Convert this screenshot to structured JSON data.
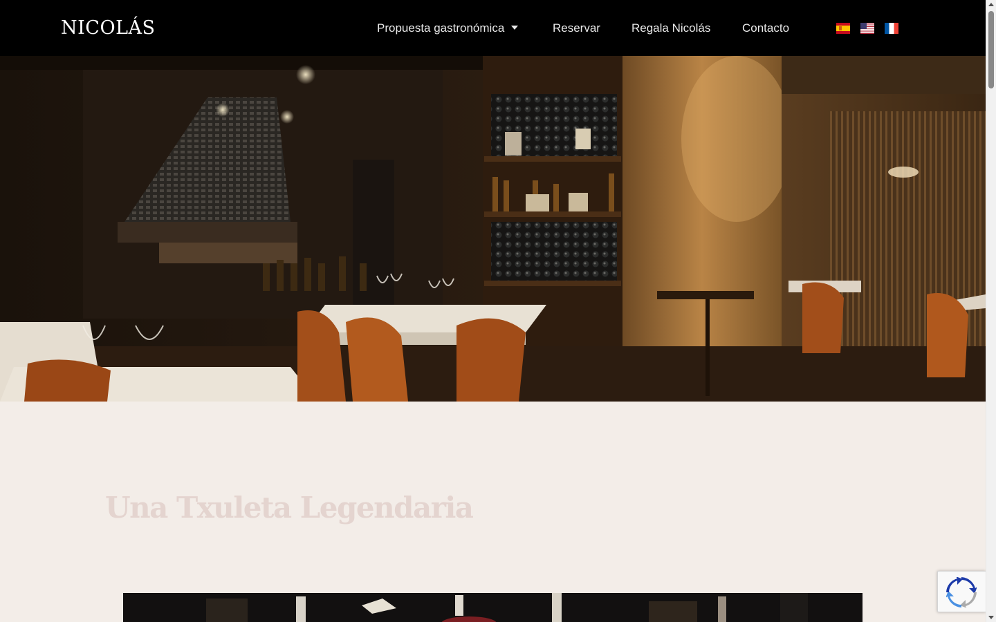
{
  "header": {
    "logo": "NICOLÁS",
    "nav": [
      {
        "label": "Propuesta gastronómica",
        "has_dropdown": true
      },
      {
        "label": "Reservar"
      },
      {
        "label": "Regala Nicolás"
      },
      {
        "label": "Contacto"
      }
    ],
    "languages": [
      {
        "icon": "flag-spain-icon"
      },
      {
        "icon": "flag-usa-icon"
      },
      {
        "icon": "flag-france-icon"
      }
    ]
  },
  "main": {
    "section_title": "Una Txuleta Legendaria"
  },
  "colors": {
    "header_bg": "#000000",
    "page_bg": "#f3ede8",
    "title_color": "#e4d4cf",
    "nav_text": "#e9e9e9"
  }
}
